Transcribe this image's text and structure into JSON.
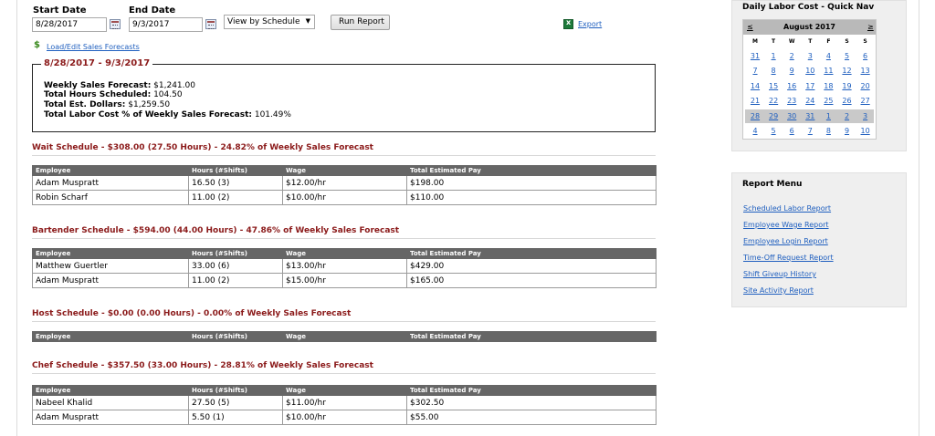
{
  "filters": {
    "start_label": "Start Date",
    "end_label": "End Date",
    "start_value": "8/28/2017",
    "end_value": "9/3/2017",
    "view_select": "View by Schedule",
    "run_button": "Run Report",
    "export_label": "Export",
    "load_forecasts_link": "Load/Edit Sales Forecasts"
  },
  "summary": {
    "range_title": "8/28/2017 - 9/3/2017",
    "lines": [
      {
        "label": "Weekly Sales Forecast:",
        "value": "$1,241.00"
      },
      {
        "label": "Total Hours Scheduled:",
        "value": "104.50"
      },
      {
        "label": "Total Est. Dollars:",
        "value": "$1,259.50"
      },
      {
        "label": "Total Labor Cost % of Weekly Sales Forecast:",
        "value": "101.49%"
      }
    ]
  },
  "table_headers": [
    "Employee",
    "Hours (#Shifts)",
    "Wage",
    "Total Estimated Pay"
  ],
  "schedules": [
    {
      "title": "Wait Schedule - $308.00 (27.50 Hours) - 24.82% of Weekly Sales Forecast",
      "rows": [
        [
          "Adam Muspratt",
          "16.50 (3)",
          "$12.00/hr",
          "$198.00"
        ],
        [
          "Robin Scharf",
          "11.00 (2)",
          "$10.00/hr",
          "$110.00"
        ]
      ]
    },
    {
      "title": "Bartender Schedule - $594.00 (44.00 Hours) - 47.86% of Weekly Sales Forecast",
      "rows": [
        [
          "Matthew Guertler",
          "33.00 (6)",
          "$13.00/hr",
          "$429.00"
        ],
        [
          "Adam Muspratt",
          "11.00 (2)",
          "$15.00/hr",
          "$165.00"
        ]
      ]
    },
    {
      "title": "Host Schedule - $0.00 (0.00 Hours) - 0.00% of Weekly Sales Forecast",
      "rows": []
    },
    {
      "title": "Chef Schedule - $357.50 (33.00 Hours) - 28.81% of Weekly Sales Forecast",
      "rows": [
        [
          "Nabeel Khalid",
          "27.50 (5)",
          "$11.00/hr",
          "$302.50"
        ],
        [
          "Adam Muspratt",
          "5.50 (1)",
          "$10.00/hr",
          "$55.00"
        ]
      ]
    }
  ],
  "quick_nav": {
    "title": "Daily Labor Cost - Quick Nav",
    "prev": "≤",
    "next": "≥",
    "month": "August 2017",
    "dow": [
      "M",
      "T",
      "W",
      "T",
      "F",
      "S",
      "S"
    ],
    "weeks": [
      [
        "31",
        "1",
        "2",
        "3",
        "4",
        "5",
        "6"
      ],
      [
        "7",
        "8",
        "9",
        "10",
        "11",
        "12",
        "13"
      ],
      [
        "14",
        "15",
        "16",
        "17",
        "18",
        "19",
        "20"
      ],
      [
        "21",
        "22",
        "23",
        "24",
        "25",
        "26",
        "27"
      ],
      [
        "28",
        "29",
        "30",
        "31",
        "1",
        "2",
        "3"
      ],
      [
        "4",
        "5",
        "6",
        "7",
        "8",
        "9",
        "10"
      ]
    ],
    "highlighted_week": 4
  },
  "report_menu": {
    "title": "Report Menu",
    "items": [
      "Scheduled Labor Report",
      "Employee Wage Report",
      "Employee Login Report",
      "Time-Off Request Report",
      "Shift Giveup History",
      "Site Activity Report"
    ]
  },
  "colors": {
    "section_title": "#8b1a1a",
    "table_header_bg": "#666666",
    "link": "#1f5fbf",
    "panel_bg": "#efefef"
  }
}
